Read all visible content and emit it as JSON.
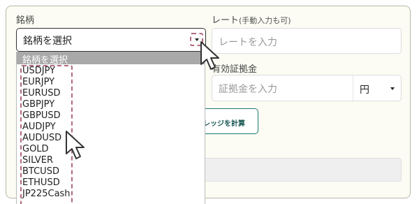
{
  "form": {
    "symbol_label": "銘柄",
    "rate_label": "レート",
    "rate_note": "(手動入力も可)",
    "rate_placeholder": "レートを入力",
    "margin_label": "有効証拠金",
    "margin_placeholder": "証拠金を入力",
    "currency_value": "円",
    "calc_button_label": "レッジを計算"
  },
  "symbol_select": {
    "selected_value": "銘柄を選択",
    "options_header": "銘柄を選択",
    "options": [
      "USDJPY",
      "EURJPY",
      "EURUSD",
      "GBPJPY",
      "GBPUSD",
      "AUDJPY",
      "AUDUSD",
      "GOLD",
      "SILVER",
      "BTCUSD",
      "ETHUSD",
      "JP225Cash"
    ]
  },
  "icons": [
    "chevron-down-icon",
    "mouse-pointer-icon"
  ]
}
